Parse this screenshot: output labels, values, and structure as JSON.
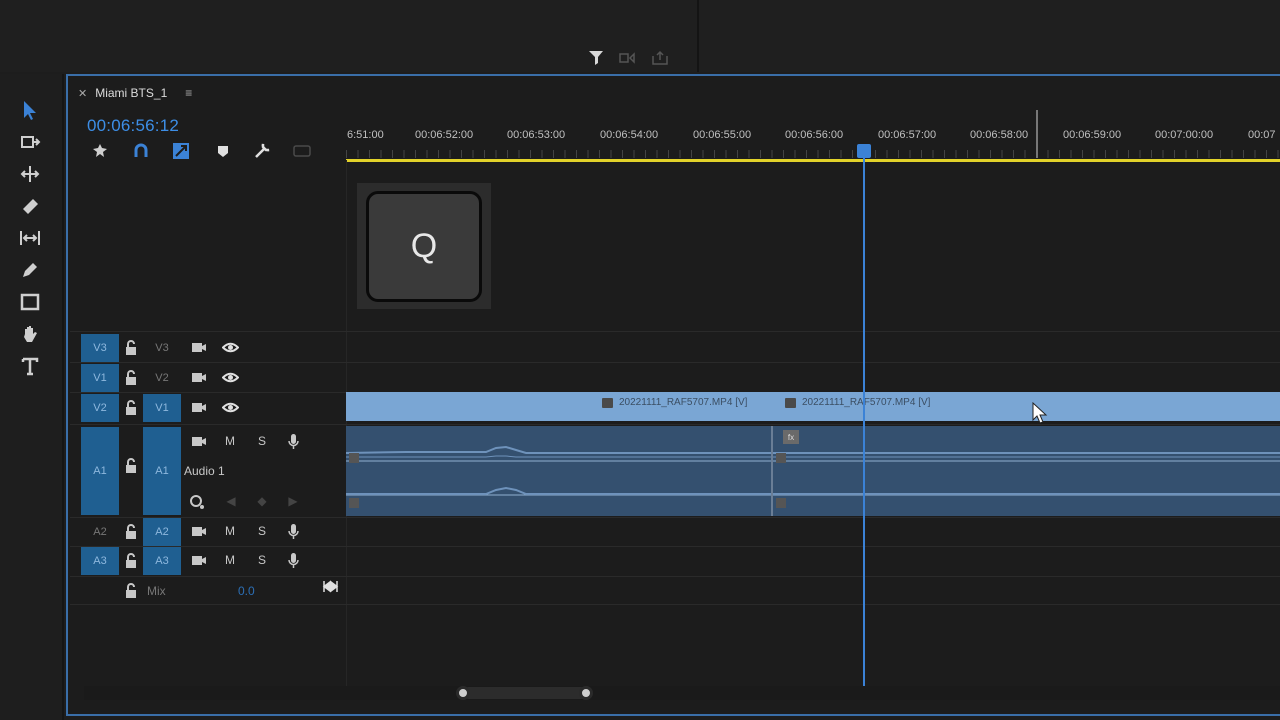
{
  "sequence": {
    "tab_name": "Miami BTS_1",
    "timecode": "00:06:56:12"
  },
  "ruler": {
    "ticks": [
      "6:51:00",
      "00:06:52:00",
      "00:06:53:00",
      "00:06:54:00",
      "00:06:55:00",
      "00:06:56:00",
      "00:06:57:00",
      "00:06:58:00",
      "00:06:59:00",
      "00:07:00:00",
      "00:07"
    ]
  },
  "overlay": {
    "key": "Q"
  },
  "tracks": {
    "v3": {
      "src": "V3",
      "tgt": "V3"
    },
    "v2": {
      "src": "V1",
      "tgt": "V2"
    },
    "v1": {
      "src": "V2",
      "tgt": "V1"
    },
    "a1": {
      "src": "A1",
      "tgt": "A1",
      "name": "Audio 1",
      "m": "M",
      "s": "S"
    },
    "a2": {
      "src": "A2",
      "tgt": "A2",
      "m": "M",
      "s": "S"
    },
    "a3": {
      "src": "A3",
      "tgt": "A3",
      "m": "M",
      "s": "S"
    },
    "mix": {
      "label": "Mix",
      "value": "0.0"
    }
  },
  "clips": {
    "video_a": "20221111_RAF5707.MP4 [V]",
    "video_b": "20221111_RAF5707.MP4 [V]",
    "audio_fx_badge": "fx"
  },
  "icons": {
    "tools": [
      "selection-tool-icon",
      "track-select-icon",
      "ripple-edit-icon",
      "razor-icon",
      "slip-icon",
      "pen-icon",
      "rectangle-icon",
      "hand-icon",
      "type-icon"
    ],
    "timeline_tools": [
      "nest-icon",
      "snap-icon",
      "linked-selection-icon",
      "add-marker-icon",
      "timeline-settings-icon",
      "captions-icon"
    ]
  },
  "colors": {
    "accent": "#3b82d6",
    "video_clip": "#7aa6d4",
    "audio_clip": "#34506f",
    "work_area": "#e2d22a"
  }
}
